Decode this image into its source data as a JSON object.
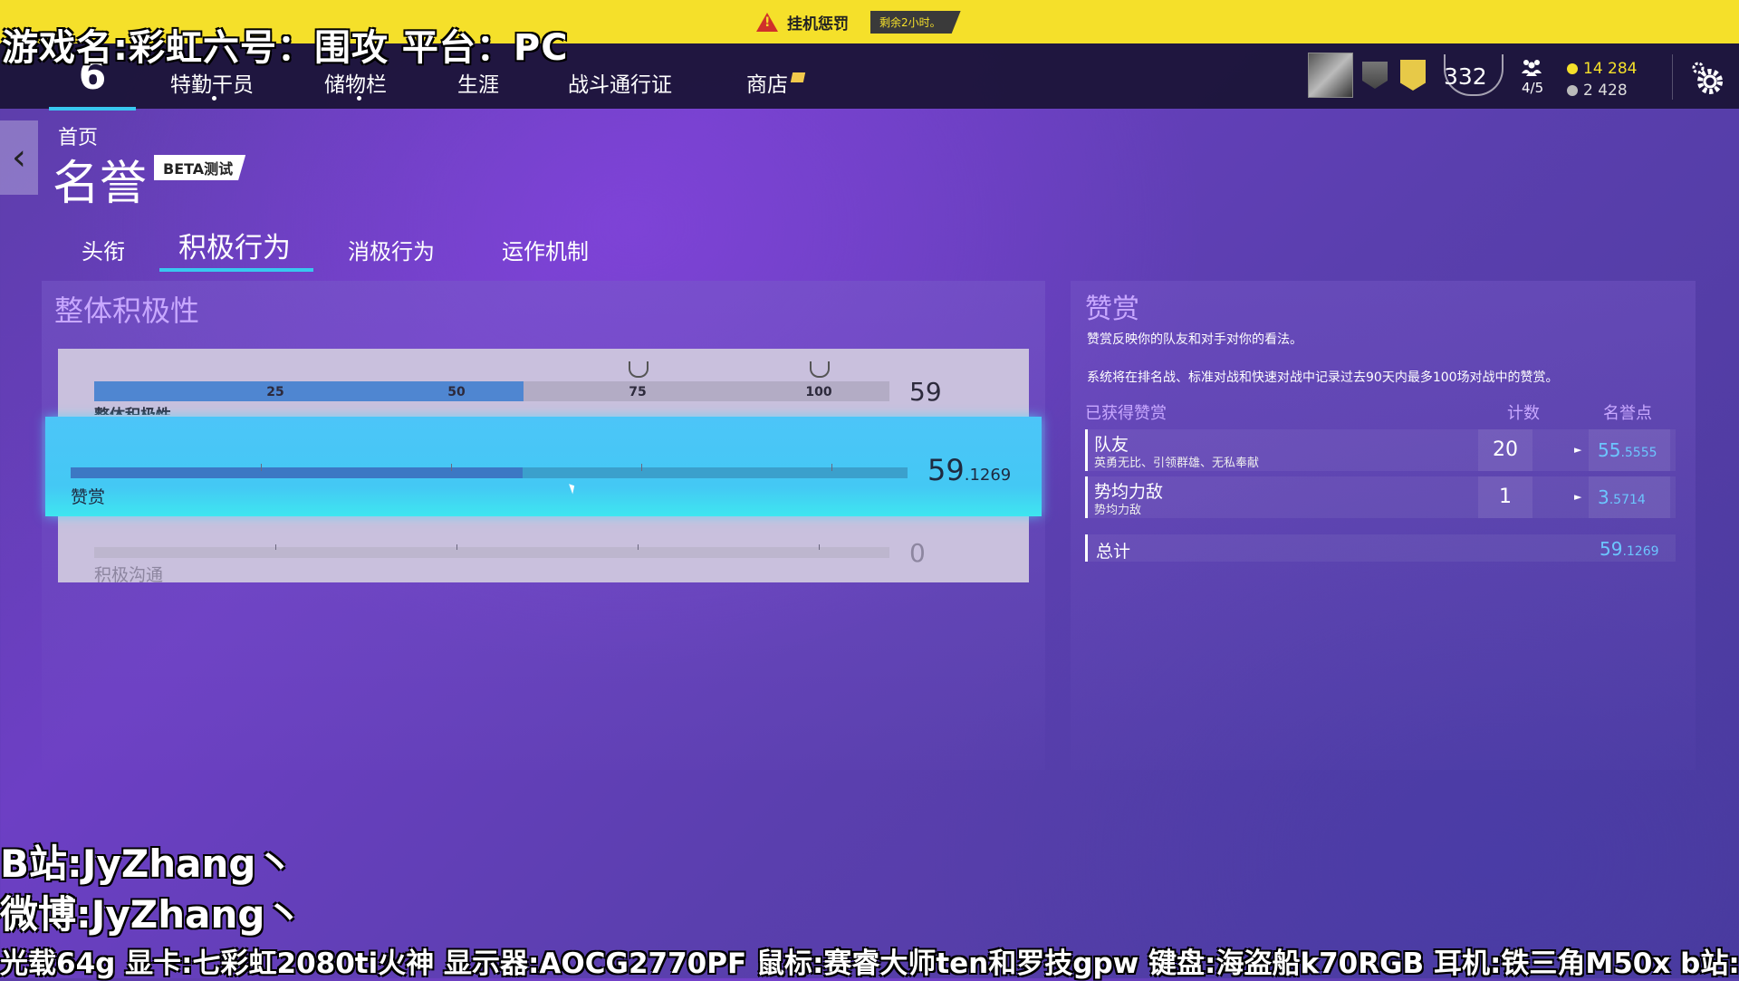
{
  "warning": {
    "text": "挂机惩罚",
    "timer": "剩余2小时。"
  },
  "overlay": {
    "game": "游戏名:彩虹六号：围攻   平台：PC",
    "bili": "B站:JyZhang丶",
    "weibo": "微博:JyZhang丶",
    "specs": "光载64g  显卡:七彩虹2080ti火神  显示器:AOCG2770PF  鼠标:赛睿大师ten和罗技gpw  键盘:海盗船k70RGB  耳机:铁三角M50x  b站: jyzhang丶  微博:jy"
  },
  "nav": {
    "logo": "6",
    "items": [
      "特勤干员",
      "储物栏",
      "生涯",
      "战斗通行证",
      "商店"
    ]
  },
  "profile": {
    "level": "332",
    "squad": "4/5",
    "currency_1": "14 284",
    "currency_2": "2 428"
  },
  "header": {
    "crumb": "首页",
    "title": "名誉",
    "beta": "BETA测试"
  },
  "tabs": [
    "头衔",
    "积极行为",
    "消极行为",
    "运作机制"
  ],
  "left_panel": {
    "title": "整体积极性",
    "ticks": [
      "25",
      "50",
      "75",
      "100"
    ],
    "overall": {
      "label": "整体积极性",
      "value": "59",
      "fill_percent": 54
    },
    "praise": {
      "label": "赞赏",
      "value_main": "59",
      "value_frac": ".1269",
      "fill_percent": 54
    },
    "communication": {
      "label": "积极沟通",
      "value": "0"
    }
  },
  "right_panel": {
    "title": "赞赏",
    "desc1": "赞赏反映你的队友和对手对你的看法。",
    "desc2": "系统将在排名战、标准对战和快速对战中记录过去90天内最多100场对战中的赞赏。",
    "col_earned": "已获得赞赏",
    "col_count": "计数",
    "col_points": "名誉点",
    "rows": [
      {
        "name": "队友",
        "sub": "英勇无比、引领群雄、无私奉献",
        "count": "20",
        "points_main": "55",
        "points_frac": ".5555"
      },
      {
        "name": "势均力敌",
        "sub": "势均力敌",
        "count": "1",
        "points_main": "3",
        "points_frac": ".5714"
      }
    ],
    "total_label": "总计",
    "total_main": "59",
    "total_frac": ".1269"
  },
  "colors": {
    "accent": "#39c7f0",
    "warning_bar": "#f5e02a",
    "points": "#6cc6ff",
    "panel_title": "#c8a8ff"
  }
}
